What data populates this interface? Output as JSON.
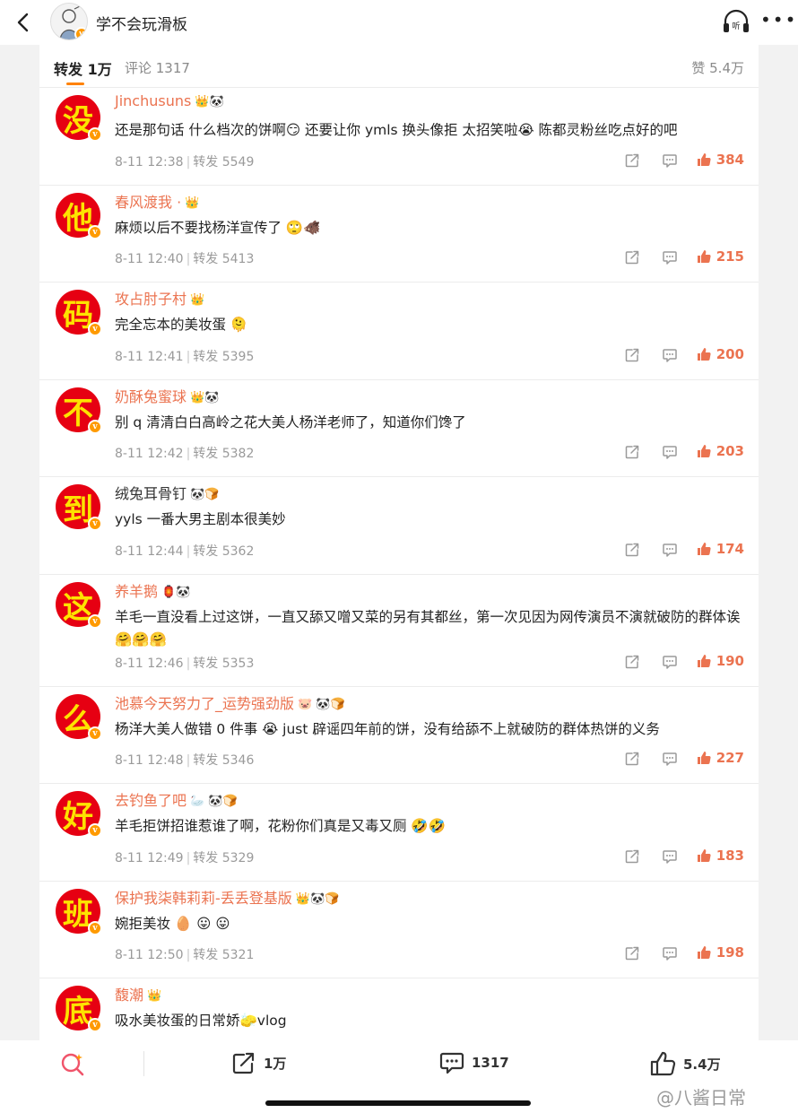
{
  "header": {
    "title": "学不会玩滑板"
  },
  "tabs": {
    "repost": "转发 1万",
    "comment": "评论 1317",
    "like": "赞 5.4万"
  },
  "items": [
    {
      "char": "没",
      "name": "Jinchusuns",
      "badges": "👑🐼",
      "text": "还是那句话 什么档次的饼啊😏 还要让你 ymls 换头像拒 太招笑啦😭 陈都灵粉丝吃点好的吧",
      "time": "8-11 12:38",
      "repost": "转发 5549",
      "likes": "384"
    },
    {
      "char": "他",
      "name": "春风渡我 ·",
      "badges": "👑",
      "text": "麻烦以后不要找杨洋宣传了 🙄🐗",
      "time": "8-11 12:40",
      "repost": "转发 5413",
      "likes": "215"
    },
    {
      "char": "码",
      "name": "攻占肘子村",
      "badges": "👑",
      "text": "完全忘本的美妆蛋 🫠",
      "time": "8-11 12:41",
      "repost": "转发 5395",
      "likes": "200"
    },
    {
      "char": "不",
      "name": "奶酥兔蜜球",
      "badges": "👑🐼",
      "text": "别 q 清清白白高岭之花大美人杨洋老师了，知道你们馋了",
      "time": "8-11 12:42",
      "repost": "转发 5382",
      "likes": "203"
    },
    {
      "char": "到",
      "name": "绒兔耳骨钉",
      "badges": "🐼🍞",
      "plain": true,
      "text": "yyls 一番大男主剧本很美妙",
      "time": "8-11 12:44",
      "repost": "转发 5362",
      "likes": "174"
    },
    {
      "char": "这",
      "name": "养羊鹅",
      "badges": "🏮🐼",
      "text": "羊毛一直没看上过这饼，一直又舔又噌又菜的另有其都丝，第一次见因为网传演员不演就破防的群体诶 🤗🤗🤗",
      "time": "8-11 12:46",
      "repost": "转发 5353",
      "likes": "190"
    },
    {
      "char": "么",
      "name": "池慕今天努力了_运势强劲版",
      "badges": "🐷 🐼🍞",
      "text": "杨洋大美人做错 0 件事 😭 just 辟谣四年前的饼，没有给舔不上就破防的群体热饼的义务",
      "time": "8-11 12:48",
      "repost": "转发 5346",
      "likes": "227"
    },
    {
      "char": "好",
      "name": "去钓鱼了吧",
      "badges": "🦢 🐼🍞",
      "text": "羊毛拒饼招谁惹谁了啊，花粉你们真是又毒又厕 🤣🤣",
      "time": "8-11 12:49",
      "repost": "转发 5329",
      "likes": "183"
    },
    {
      "char": "班",
      "name": "保护我柒韩莉莉-丢丢登基版",
      "badges": "👑🐼🍞",
      "text": "婉拒美妆 🥚 😛 😛",
      "time": "8-11 12:50",
      "repost": "转发 5321",
      "likes": "198"
    },
    {
      "char": "底",
      "name": "馥潮",
      "badges": "👑",
      "text": "吸水美妆蛋的日常娇🧽vlog",
      "time": "",
      "repost": "",
      "likes": ""
    }
  ],
  "bottombar": {
    "repost_count": "1万",
    "comment_count": "1317",
    "like_count": "5.4万"
  },
  "watermark": "@八酱日常",
  "colors": {
    "accent": "#ff8200",
    "name": "#eb7350",
    "avatar_bg": "#e60012",
    "avatar_char": "#fde300"
  }
}
